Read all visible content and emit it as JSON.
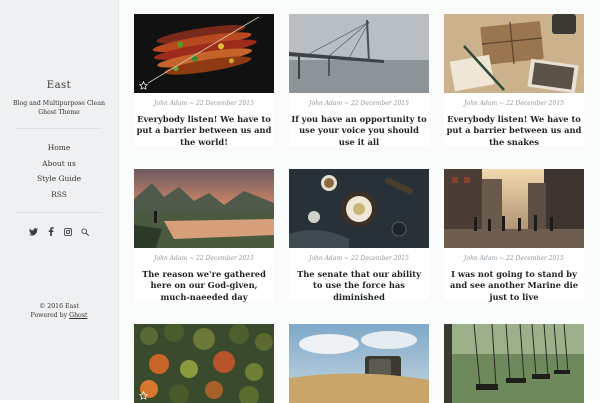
{
  "sidebar": {
    "title": "East",
    "description": "Blog and Multipurpose Clean Ghost Theme",
    "nav": [
      {
        "label": "Home"
      },
      {
        "label": "About us"
      },
      {
        "label": "Style Guide"
      },
      {
        "label": "RSS"
      }
    ],
    "social_icons": [
      "twitter-icon",
      "facebook-icon",
      "instagram-icon",
      "search-icon"
    ],
    "footer": {
      "copyright": "© 2016 East",
      "powered_prefix": "Powered by",
      "powered_link": "Ghost"
    }
  },
  "posts": [
    {
      "meta": "John Adam ~ 22 December 2015",
      "title": "Everybody listen! We have to put a barrier between us and the world!",
      "image": "skewers",
      "featured": true
    },
    {
      "meta": "John Adam ~ 22 December 2015",
      "title": "If you have an opportunity to use your voice you should use it all",
      "image": "bridge-fog",
      "featured": false
    },
    {
      "meta": "John Adam ~ 22 December 2015",
      "title": "Everybody listen! We have to put a barrier between us and the snakes",
      "image": "parcels",
      "featured": false
    },
    {
      "meta": "John Adam ~ 22 December 2015",
      "title": "The reason we're gathered here on our God-given, much-naeeded day",
      "image": "lake-sunset",
      "featured": false
    },
    {
      "meta": "John Adam ~ 22 December 2015",
      "title": "The senate that our ability to use the force has diminished",
      "image": "dark-table",
      "featured": false
    },
    {
      "meta": "John Adam ~ 22 December 2015",
      "title": "I was not going to stand by and see another Marine die just to live",
      "image": "city-street",
      "featured": false
    },
    {
      "meta": "",
      "title": "",
      "image": "autumn-forest",
      "featured": true
    },
    {
      "meta": "",
      "title": "",
      "image": "tv-field",
      "featured": false
    },
    {
      "meta": "",
      "title": "",
      "image": "swings",
      "featured": false
    }
  ],
  "colors": {
    "sidebar_bg": "#eef0f2",
    "main_bg": "#fafbfb",
    "meta_text": "#8e969c",
    "title_text": "#1f2326"
  }
}
